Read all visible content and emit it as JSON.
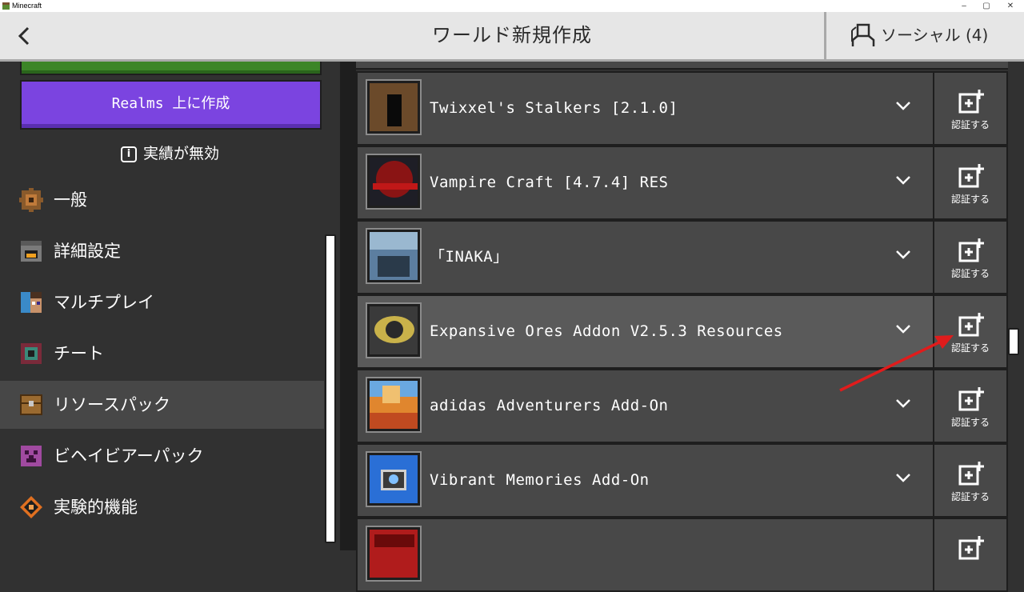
{
  "window": {
    "title": "Minecraft",
    "controls": [
      "–",
      "▢",
      "✕"
    ]
  },
  "header": {
    "title": "ワールド新規作成",
    "social_label": "ソーシャル (4)"
  },
  "left": {
    "realms_button": "Realms 上に作成",
    "achievements_text": "実績が無効",
    "info_glyph": "i",
    "nav": [
      {
        "label": "一般",
        "icon": "gear-icon"
      },
      {
        "label": "詳細設定",
        "icon": "furnace-icon"
      },
      {
        "label": "マルチプレイ",
        "icon": "player-head-icon"
      },
      {
        "label": "チート",
        "icon": "command-block-icon"
      },
      {
        "label": "リソースパック",
        "icon": "chest-icon",
        "active": true
      },
      {
        "label": "ビヘイビアーパック",
        "icon": "creeper-icon"
      },
      {
        "label": "実験的機能",
        "icon": "experiment-icon"
      }
    ]
  },
  "packs": [
    {
      "name": "Twixxel's Stalkers [2.1.0]",
      "verify": "認証する",
      "thumb_color": "#6b4a2a"
    },
    {
      "name": "Vampire Craft [4.7.4] RES",
      "verify": "認証する",
      "thumb_color": "#8a1414"
    },
    {
      "name": "「INAKA」",
      "verify": "認証する",
      "thumb_color": "#5c7ea0"
    },
    {
      "name": "Expansive Ores Addon V2.5.3 Resources",
      "verify": "認証する",
      "thumb_color": "#c9b24a",
      "hover": true
    },
    {
      "name": "adidas Adventurers Add-On",
      "verify": "認証する",
      "thumb_color": "#e0862e"
    },
    {
      "name": "Vibrant Memories Add-On",
      "verify": "認証する",
      "thumb_color": "#2a6fd6"
    },
    {
      "name": "",
      "verify": "",
      "thumb_color": "#b01c1c"
    }
  ],
  "colors": {
    "header_bg": "#e6e6e6",
    "realms_purple": "#7b44e0",
    "green_button": "#3c8527",
    "annotation_arrow": "#e01c1c"
  }
}
